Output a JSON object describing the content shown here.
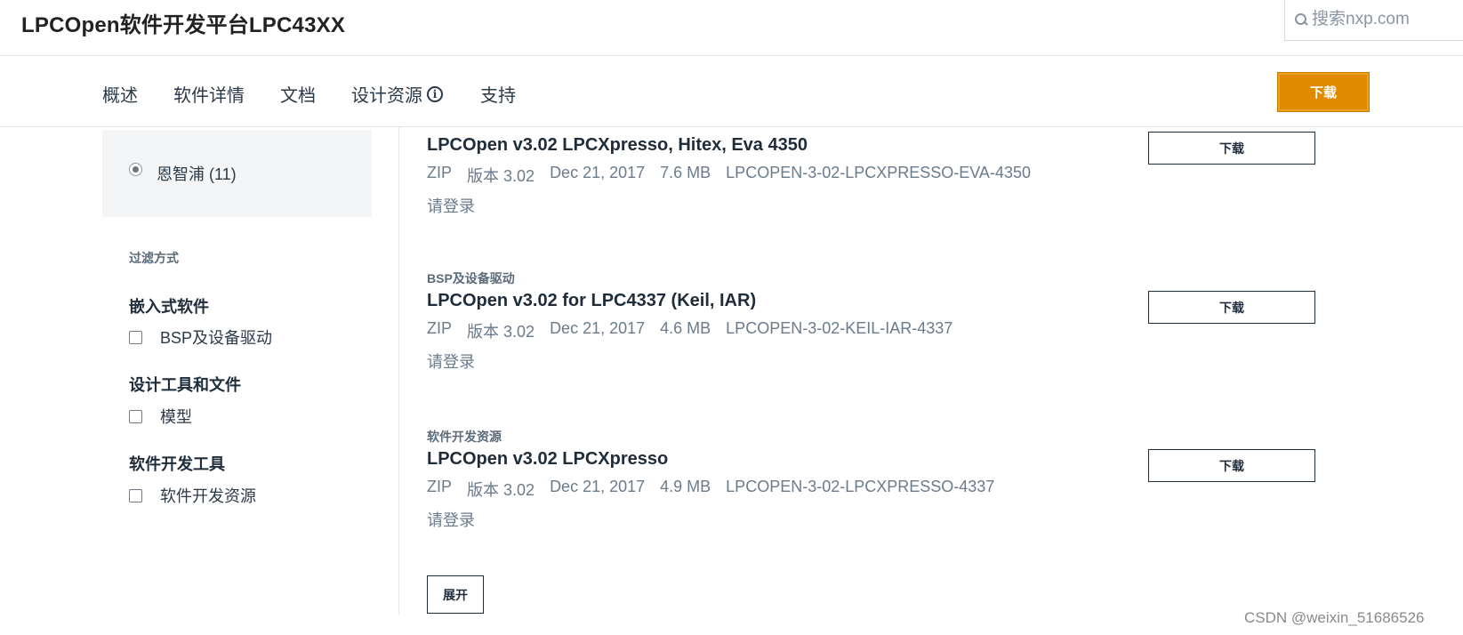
{
  "header": {
    "title": "LPCOpen软件开发平台LPC43XX",
    "search_placeholder": "搜索nxp.com"
  },
  "nav": {
    "items": [
      "概述",
      "软件详情",
      "文档",
      "设计资源",
      "支持"
    ],
    "download_label": "下载"
  },
  "sidebar": {
    "selected_vendor": "恩智浦 (11)",
    "filter_heading": "过滤方式",
    "groups": [
      {
        "title": "嵌入式软件",
        "option": "BSP及设备驱动"
      },
      {
        "title": "设计工具和文件",
        "option": "模型"
      },
      {
        "title": "软件开发工具",
        "option": "软件开发资源"
      }
    ]
  },
  "results": [
    {
      "category": "",
      "title": "LPCOpen v3.02 LPCXpresso, Hitex, Eva 4350",
      "format": "ZIP",
      "version": "版本 3.02",
      "date": "Dec 21, 2017",
      "size": "7.6 MB",
      "id": "LPCOPEN-3-02-LPCXPRESSO-EVA-4350",
      "login": "请登录",
      "download": "下载"
    },
    {
      "category": "BSP及设备驱动",
      "title": "LPCOpen v3.02 for LPC4337 (Keil, IAR)",
      "format": "ZIP",
      "version": "版本 3.02",
      "date": "Dec 21, 2017",
      "size": "4.6 MB",
      "id": "LPCOPEN-3-02-KEIL-IAR-4337",
      "login": "请登录",
      "download": "下载"
    },
    {
      "category": "软件开发资源",
      "title": "LPCOpen v3.02 LPCXpresso",
      "format": "ZIP",
      "version": "版本 3.02",
      "date": "Dec 21, 2017",
      "size": "4.9 MB",
      "id": "LPCOPEN-3-02-LPCXPRESSO-4337",
      "login": "请登录",
      "download": "下载"
    }
  ],
  "expand_label": "展开",
  "watermark": "CSDN @weixin_51686526",
  "colors": {
    "accent": "#e08a00",
    "text": "#1f2d3a",
    "meta": "#6a7b8c"
  },
  "icons": {
    "search": "search-icon",
    "info": "info-icon"
  }
}
